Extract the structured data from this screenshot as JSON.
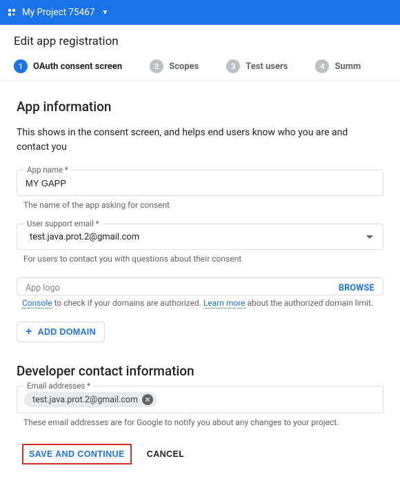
{
  "topbar": {
    "project_name": "My Project 75467"
  },
  "page": {
    "title": "Edit app registration"
  },
  "stepper": {
    "steps": [
      {
        "num": "1",
        "label": "OAuth consent screen"
      },
      {
        "num": "2",
        "label": "Scopes"
      },
      {
        "num": "3",
        "label": "Test users"
      },
      {
        "num": "4",
        "label": "Summ"
      }
    ]
  },
  "app_info": {
    "heading": "App information",
    "sub": "This shows in the consent screen, and helps end users know who you are and contact you",
    "name_label": "App name *",
    "name_value": "MY GAPP",
    "name_helper": "The name of the app asking for consent",
    "email_label": "User support email *",
    "email_value": "test.java.prot.2@gmail.com",
    "email_helper": "For users to contact you with questions about their consent",
    "logo_label": "App logo",
    "browse_label": "BROWSE"
  },
  "domains": {
    "hint_prefix": "Console",
    "hint_mid": " to check if your domains are authorized. ",
    "hint_link": "Learn more",
    "hint_suffix": " about the authorized domain limit.",
    "add_label": "ADD DOMAIN"
  },
  "dev": {
    "heading": "Developer contact information",
    "chip_label": "Email addresses *",
    "chip_value": "test.java.prot.2@gmail.com",
    "helper": "These email addresses are for Google to notify you about any changes to your project."
  },
  "actions": {
    "save": "SAVE AND CONTINUE",
    "cancel": "CANCEL"
  }
}
